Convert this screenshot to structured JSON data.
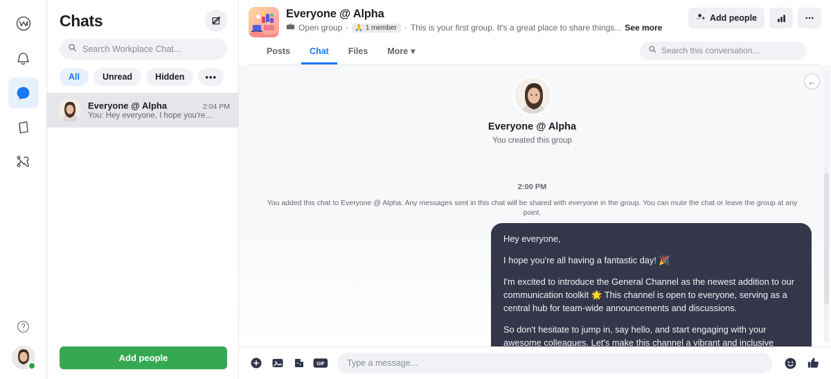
{
  "rail": {
    "items": [
      {
        "icon": "workplace-logo-icon",
        "name": "workplace-home"
      },
      {
        "icon": "bell-icon",
        "name": "notifications"
      },
      {
        "icon": "chat-bubble-icon",
        "name": "chat",
        "active": true
      },
      {
        "icon": "book-icon",
        "name": "knowledge-library"
      },
      {
        "icon": "tools-icon",
        "name": "admin-tools"
      }
    ],
    "help_icon": "question-mark-icon",
    "status": "online"
  },
  "chat_list": {
    "title": "Chats",
    "compose_icon": "compose-icon",
    "search": {
      "placeholder": "Search Workplace Chat...",
      "value": "",
      "icon": "search-icon"
    },
    "filters": [
      {
        "label": "All",
        "active": true
      },
      {
        "label": "Unread",
        "active": false
      },
      {
        "label": "Hidden",
        "active": false
      },
      {
        "label": "•••",
        "active": false
      }
    ],
    "items": [
      {
        "name": "Everyone @ Alpha",
        "snippet": "You: Hey everyone, I hope you're...",
        "time": "2:04 PM",
        "selected": true
      }
    ],
    "add_people_label": "Add people"
  },
  "conversation": {
    "title": "Everyone @ Alpha",
    "group_type": "Open group",
    "group_type_icon": "briefcase-icon",
    "member_count": "1 member",
    "member_icon": "🙏",
    "separator": "·",
    "description": "This is your first group. It's a great place to share things...",
    "see_more": "See more",
    "actions": {
      "add_people_label": "Add people",
      "add_people_icon": "add-person-icon",
      "insights_icon": "bar-chart-icon",
      "more_icon": "ellipsis-icon"
    },
    "tabs": [
      {
        "label": "Posts",
        "active": false
      },
      {
        "label": "Chat",
        "active": true
      },
      {
        "label": "Files",
        "active": false
      },
      {
        "label": "More",
        "active": false,
        "caret": "▾"
      }
    ],
    "search": {
      "placeholder": "Search this conversation...",
      "value": "",
      "icon": "search-icon"
    },
    "intro": {
      "name": "Everyone @ Alpha",
      "note": "You created this group"
    },
    "timestamp": "2:00 PM",
    "system_note": "You added this chat to Everyone @ Alpha. Any messages sent in this chat will be shared with everyone in the group. You can mute the chat or leave the group at any point.",
    "message": {
      "paragraphs": [
        "Hey everyone,",
        "I hope you're all having a fantastic day! 🎉",
        "I'm excited to introduce the General Channel as the newest addition to our communication toolkit 🌟 This channel is open to everyone, serving as a central hub for team-wide announcements and discussions.",
        "So don't hesitate to jump in, say hello, and start engaging with your awesome colleagues. Let's make this channel a vibrant and inclusive space for all of us to connect and collaborate!"
      ],
      "status_icon": "sent-check-icon"
    },
    "collapse_icon": "←"
  },
  "composer": {
    "placeholder": "Type a message...",
    "value": "",
    "icons": [
      {
        "name": "add-attachment-icon",
        "glyph": "plus-circle"
      },
      {
        "name": "photo-icon",
        "glyph": "image"
      },
      {
        "name": "sticker-icon",
        "glyph": "sticker"
      },
      {
        "name": "gif-icon",
        "glyph": "GIF"
      }
    ],
    "right_icons": [
      {
        "name": "emoji-icon",
        "glyph": "smiley"
      },
      {
        "name": "thumbs-up-icon",
        "glyph": "thumbsup"
      }
    ]
  },
  "colors": {
    "accent_blue": "#1877f2",
    "green_button": "#36a852",
    "bubble_dark": "#34374a",
    "online_green": "#31a24c"
  }
}
